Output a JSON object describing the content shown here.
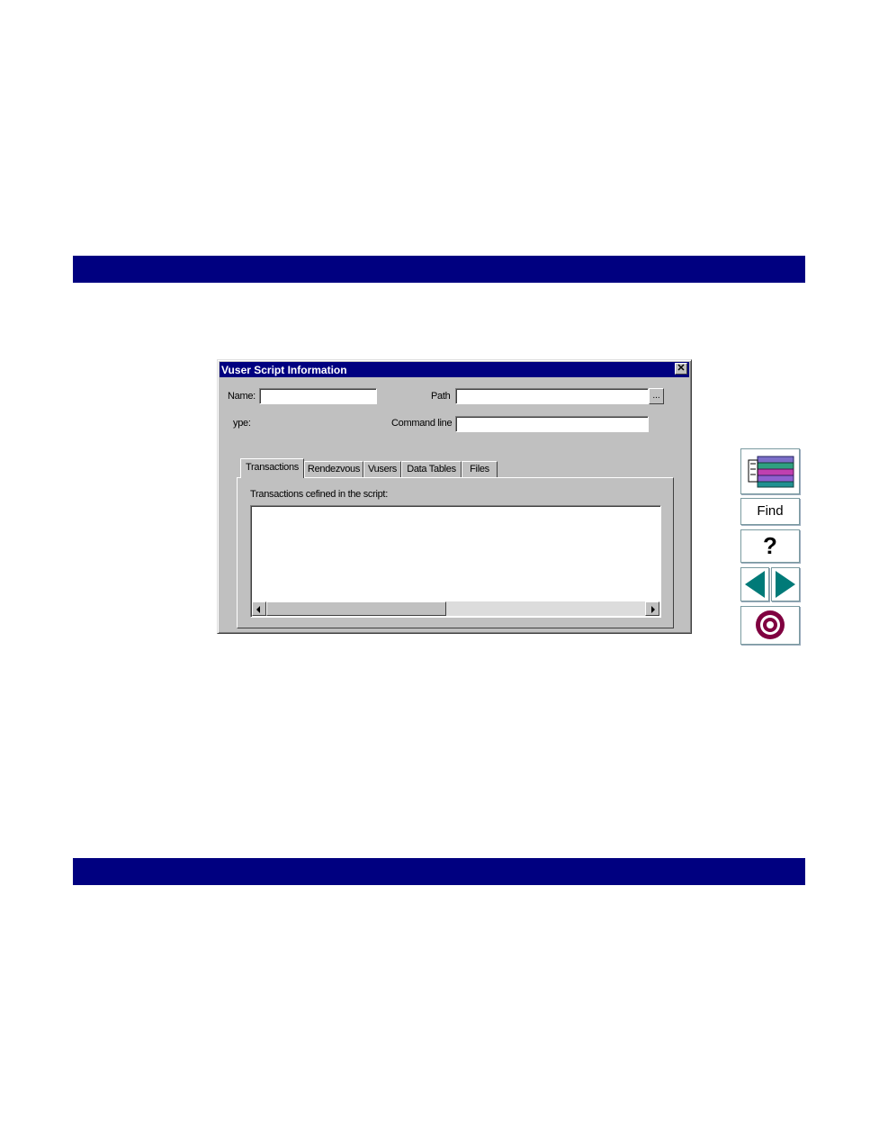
{
  "dialog": {
    "title": "Vuser Script Information",
    "close_label": "✕",
    "name_label": "Name:",
    "name_value": "",
    "path_label": "Path",
    "path_value": "",
    "browse_label": "...",
    "type_label": "ype:",
    "command_line_label": "Command line",
    "command_line_value": ""
  },
  "tabs": [
    {
      "label": "Transactions",
      "active": true
    },
    {
      "label": "Rendezvous",
      "active": false
    },
    {
      "label": "Vusers",
      "active": false
    },
    {
      "label": "Data Tables",
      "active": false
    },
    {
      "label": "Files",
      "active": false
    }
  ],
  "panel": {
    "list_label": "Transactions cefined in the script:"
  },
  "nav": {
    "find_label": "Find",
    "help_label": "?"
  },
  "colors": {
    "banner": "#000080",
    "nav_teal": "#007a78",
    "nav_purple": "#800040"
  },
  "icons": [
    "books-icon",
    "search-find-icon",
    "help-icon",
    "back-arrow-icon",
    "forward-arrow-icon",
    "target-icon"
  ]
}
